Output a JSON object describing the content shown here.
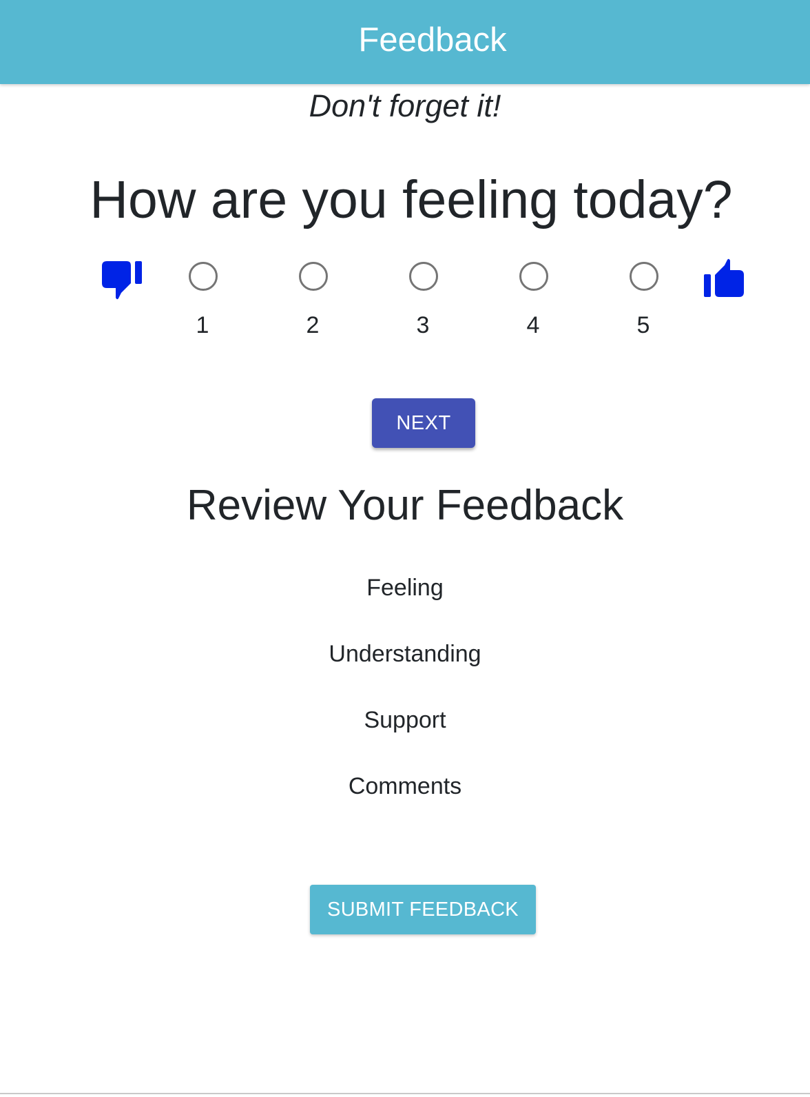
{
  "header": {
    "title": "Feedback",
    "background_color": "#56b8d1"
  },
  "tagline": "Don't forget it!",
  "question": {
    "text": "How are you feeling today?",
    "low_icon": "thumbs-down-icon",
    "high_icon": "thumbs-up-icon",
    "icon_color": "#0023e6",
    "options": [
      {
        "label": "1",
        "selected": false
      },
      {
        "label": "2",
        "selected": false
      },
      {
        "label": "3",
        "selected": false
      },
      {
        "label": "4",
        "selected": false
      },
      {
        "label": "5",
        "selected": false
      }
    ]
  },
  "next_button": {
    "label": "NEXT",
    "color": "#4251b5"
  },
  "review": {
    "title": "Review Your Feedback",
    "items": [
      "Feeling",
      "Understanding",
      "Support",
      "Comments"
    ]
  },
  "submit_button": {
    "label": "SUBMIT FEEDBACK",
    "color": "#56b8d1"
  }
}
